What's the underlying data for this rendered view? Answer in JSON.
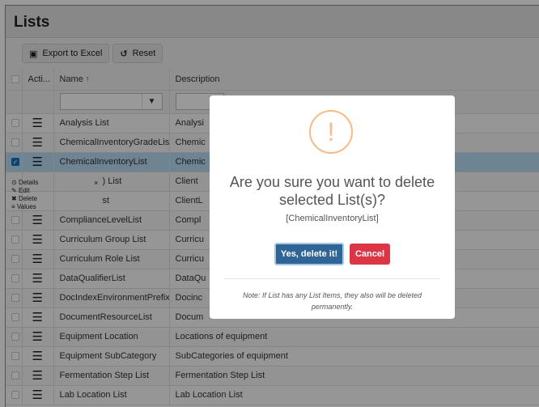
{
  "panel": {
    "title": "Lists"
  },
  "toolbar": {
    "export_label": "Export to Excel",
    "export_icon": "excel-icon",
    "reset_label": "Reset",
    "reset_icon": "undo-icon"
  },
  "grid": {
    "columns": {
      "actions": "Acti...",
      "name": "Name",
      "sort_indicator": "↑",
      "description": "Description"
    },
    "filter": {
      "name_value": "",
      "filter_icon": "▼"
    },
    "rows": [
      {
        "name": "Analysis List",
        "description": "Analysi",
        "checked": false
      },
      {
        "name": "ChemicalInventoryGradeList",
        "description": "Chemic",
        "checked": false
      },
      {
        "name": "ChemicalInventoryList",
        "description": "Chemic",
        "checked": true
      },
      {
        "name": "",
        "description": "",
        "checked": false
      },
      {
        "name": "",
        "description": "",
        "checked": false
      },
      {
        "name": "ComplianceLevelList",
        "description": "Compl",
        "checked": false
      },
      {
        "name": "Curriculum Group List",
        "description": "Curricu",
        "checked": false
      },
      {
        "name": "Curriculum Role List",
        "description": "Curricu",
        "checked": false
      },
      {
        "name": "DataQualifierList",
        "description": "DataQu",
        "checked": false
      },
      {
        "name": "DocIndexEnvironmentPrefixList",
        "description": "Docinc",
        "checked": false
      },
      {
        "name": "DocumentResourceList",
        "description": "Docum",
        "checked": false
      },
      {
        "name": "Equipment Location",
        "description": "Locations of equipment",
        "checked": false
      },
      {
        "name": "Equipment SubCategory",
        "description": "SubCategories of equipment",
        "checked": false
      },
      {
        "name": "Fermentation Step List",
        "description": "Fermentation Step List",
        "checked": false
      },
      {
        "name": "Lab Location List",
        "description": "Lab Location List",
        "checked": false
      }
    ],
    "partial_row4_name": ") List",
    "partial_row4_desc": "Client",
    "partial_row5_name": "st",
    "partial_row5_desc": "ClientL"
  },
  "context_menu": {
    "items": [
      {
        "icon": "⊙",
        "label": "Details"
      },
      {
        "icon": "✎",
        "label": "Edit"
      },
      {
        "icon": "✖",
        "label": "Delete"
      },
      {
        "icon": "≡",
        "label": "Values"
      }
    ],
    "close": "×"
  },
  "modal": {
    "icon": "!",
    "title": "Are you sure you want to delete selected List(s)?",
    "item": "[ChemicalInventoryList]",
    "confirm_label": "Yes, delete it!",
    "cancel_label": "Cancel",
    "note": "Note: If List has any List Items, they also will be deleted permanently.",
    "colors": {
      "confirm": "#2f6496",
      "cancel": "#dc3545",
      "warning": "#f8bb86"
    }
  }
}
